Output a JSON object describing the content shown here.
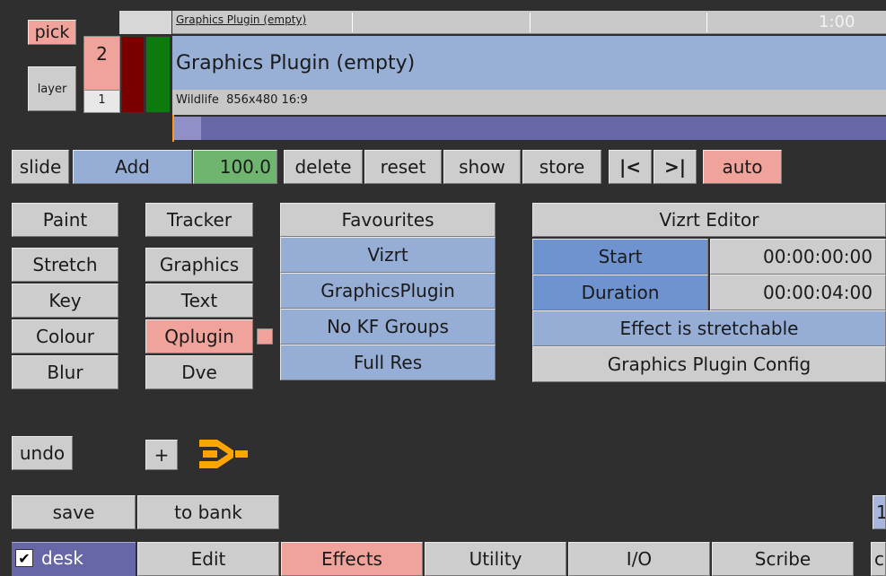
{
  "timeline": {
    "pick_label": "pick",
    "layer_label": "layer",
    "layer_number": "2",
    "sub_number": "1",
    "header_clip_title": "Graphics Plugin (empty)",
    "time_readout": "1:00",
    "clip_title": "Graphics Plugin (empty)",
    "clip_subtitle": "Wildlife  856x480 16:9"
  },
  "keyframe_bar": {
    "slide": "slide",
    "add": "Add",
    "value": "100.0",
    "delete": "delete",
    "reset": "reset",
    "show": "show",
    "store": "store",
    "prev": "|<",
    "next": ">|",
    "auto": "auto"
  },
  "left_col": [
    "Paint",
    "Stretch",
    "Key",
    "Colour",
    "Blur"
  ],
  "mid_col": [
    "Tracker",
    "Graphics",
    "Text",
    "Qplugin",
    "Dve"
  ],
  "favourites": {
    "header": "Favourites",
    "items": [
      "Vizrt",
      "GraphicsPlugin",
      "No KF Groups",
      "Full Res"
    ]
  },
  "editor": {
    "header": "Vizrt Editor",
    "start_label": "Start",
    "start_value": "00:00:00:00",
    "duration_label": "Duration",
    "duration_value": "00:00:04:00",
    "stretchable": "Effect is stretchable",
    "config": "Graphics Plugin Config"
  },
  "actions": {
    "undo": "undo",
    "plus": "+",
    "save": "save",
    "to_bank": "to bank",
    "partial_right": "1"
  },
  "tabs": {
    "desk_check": "✔",
    "desk": "desk",
    "items": [
      "Edit",
      "Effects",
      "Utility",
      "I/O",
      "Scribe"
    ],
    "partial": "c"
  },
  "colors": {
    "accent_red": "#f0a39a",
    "accent_blue": "#96aed6",
    "accent_green": "#6fb46f",
    "orange_icon": "#ffa500"
  }
}
